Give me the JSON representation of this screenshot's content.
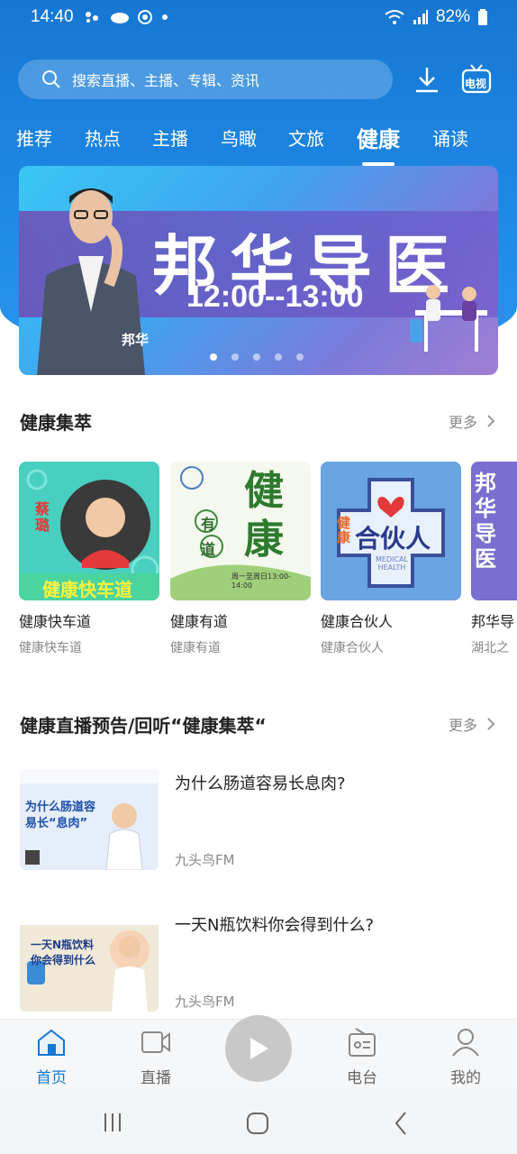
{
  "status_bar": {
    "time": "14:40",
    "battery": "82%"
  },
  "search": {
    "placeholder": "搜索直播、主播、专辑、资讯"
  },
  "header": {
    "tv_label": "电视"
  },
  "tabs": [
    {
      "label": "推荐",
      "active": false
    },
    {
      "label": "热点",
      "active": false
    },
    {
      "label": "主播",
      "active": false
    },
    {
      "label": "鸟瞰",
      "active": false
    },
    {
      "label": "文旅",
      "active": false
    },
    {
      "label": "健康",
      "active": true
    },
    {
      "label": "诵读",
      "active": false
    }
  ],
  "banner": {
    "title": "邦华导医",
    "time": "12:00--13:00",
    "brand": "邦华",
    "page_count": 5,
    "current_page": 1
  },
  "section1": {
    "title": "健康集萃",
    "more": "更多",
    "cards": [
      {
        "name": "健康快车道",
        "sub": "健康快车道",
        "thumb_text": "健康快车道",
        "thumb_side": "蔡璐"
      },
      {
        "name": "健康有道",
        "sub": "健康有道",
        "thumb_text": "健康",
        "thumb_small": "有道",
        "thumb_caption": "周一至周日13:00-14:00"
      },
      {
        "name": "健康合伙人",
        "sub": "健康合伙人",
        "thumb_text": "合伙人",
        "thumb_left": "健康",
        "thumb_caption": "MEDICAL HEALTH"
      },
      {
        "name": "邦华导",
        "sub": "湖北之",
        "thumb_text": "邦华导医"
      }
    ]
  },
  "section2": {
    "title": "健康直播预告/回听“健康集萃“",
    "more": "更多",
    "items": [
      {
        "title": "为什么肠道容易长息肉?",
        "source": "九头鸟FM",
        "thumb_text": "为什么肠道容易长“息肉”"
      },
      {
        "title": "一天N瓶饮料你会得到什么?",
        "source": "九头鸟FM",
        "thumb_text": "一天N瓶饮料你会得到什么"
      }
    ]
  },
  "bottom_nav": [
    {
      "label": "首页",
      "icon": "home-icon",
      "active": true
    },
    {
      "label": "直播",
      "icon": "video-icon",
      "active": false
    },
    {
      "label": "电台",
      "icon": "radio-icon",
      "active": false
    },
    {
      "label": "我的",
      "icon": "user-icon",
      "active": false
    }
  ],
  "colors": {
    "primary": "#1677d2",
    "accent_active": "#1677d2"
  }
}
